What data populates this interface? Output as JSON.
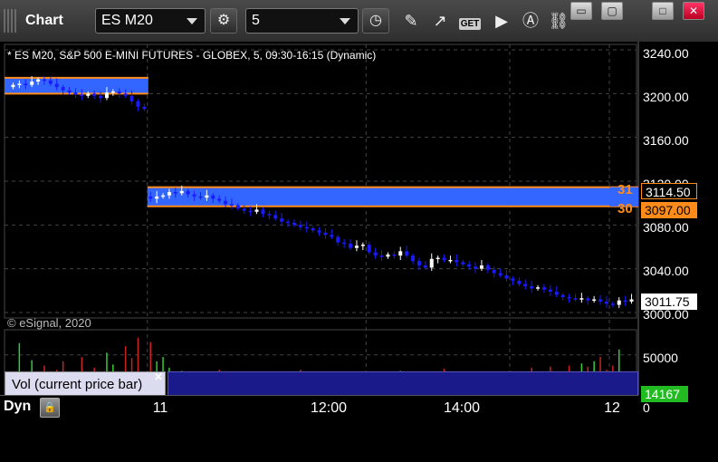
{
  "window": {
    "title": "Chart",
    "controls": [
      "▭",
      "▢",
      "□",
      "✕"
    ]
  },
  "toolbar": {
    "symbol": "ES M20",
    "interval": "5"
  },
  "chart": {
    "header": "* ES M20, S&P 500 E-MINI FUTURES - GLOBEX, 5, 09:30-16:15 (Dynamic)",
    "copyright": "© eSignal, 2020",
    "price_labels": [
      "3240.00",
      "3200.00",
      "3160.00",
      "3120.00",
      "3080.00",
      "3040.00",
      "3000.00"
    ],
    "band_high": {
      "value": "3114.50",
      "left_cut": "31"
    },
    "band_low": {
      "value": "3097.00",
      "left_cut": "30"
    },
    "last_price": "3011.75",
    "volume_labels": [
      "50000",
      "0"
    ],
    "last_volume": "14167",
    "volume_study": "Vol (current price bar)",
    "time_labels": [
      "11",
      "12:00",
      "14:00",
      "12"
    ],
    "mode": "Dyn",
    "colors": {
      "band_fill": "#3366ff",
      "band_edge": "#ff8c1a",
      "up": "#ffffff",
      "down": "#1a1aff",
      "vol_up": "#33cc33",
      "vol_down": "#cc2222"
    }
  },
  "chart_data": {
    "type": "candlestick",
    "title": "* ES M20, S&P 500 E-MINI FUTURES - GLOBEX, 5, 09:30-16:15 (Dynamic)",
    "xlabel": "",
    "ylabel": "",
    "ylim": [
      2995,
      3245
    ],
    "bands": [
      {
        "session": 1,
        "top": 3214.5,
        "bottom": 3200.0
      },
      {
        "session": 2,
        "top": 3114.5,
        "bottom": 3097.0
      }
    ],
    "sessions": [
      {
        "start": 0,
        "end": 21
      },
      {
        "start": 22,
        "end": 99
      }
    ],
    "close_series": [
      3208,
      3209,
      3208,
      3211,
      3213,
      3212,
      3209,
      3206,
      3203,
      3201,
      3199,
      3198,
      3200,
      3198,
      3196,
      3201,
      3202,
      3200,
      3198,
      3193,
      3188,
      3186,
      3104,
      3106,
      3107,
      3110,
      3109,
      3111,
      3108,
      3106,
      3105,
      3107,
      3104,
      3102,
      3099,
      3098,
      3095,
      3093,
      3092,
      3094,
      3090,
      3089,
      3086,
      3083,
      3082,
      3080,
      3078,
      3077,
      3075,
      3073,
      3071,
      3069,
      3064,
      3063,
      3059,
      3061,
      3062,
      3055,
      3052,
      3051,
      3053,
      3052,
      3056,
      3052,
      3047,
      3043,
      3041,
      3049,
      3050,
      3048,
      3048,
      3046,
      3044,
      3042,
      3040,
      3043,
      3039,
      3036,
      3034,
      3031,
      3029,
      3026,
      3024,
      3022,
      3023,
      3021,
      3019,
      3016,
      3014,
      3013,
      3012,
      3013,
      3011,
      3012,
      3010,
      3008,
      3007,
      3011,
      3010,
      3012
    ],
    "volume_series": [
      32000,
      61000,
      22000,
      45000,
      28000,
      40000,
      19000,
      36000,
      44000,
      25000,
      30000,
      48000,
      27000,
      38000,
      33000,
      52000,
      41000,
      29000,
      58000,
      47000,
      66000,
      24000,
      62000,
      44000,
      48000,
      38000,
      29000,
      35000,
      26000,
      30000,
      32000,
      28000,
      22000,
      36000,
      34000,
      24000,
      30000,
      27000,
      33000,
      23000,
      26000,
      29000,
      31000,
      30000,
      22000,
      24000,
      36000,
      28000,
      21000,
      26000,
      33000,
      30000,
      27000,
      25000,
      22000,
      29000,
      31000,
      24000,
      20000,
      26000,
      28000,
      23000,
      35000,
      30000,
      34000,
      25000,
      29000,
      31000,
      24000,
      37000,
      22000,
      30000,
      27000,
      21000,
      26000,
      32000,
      28000,
      30000,
      33000,
      23000,
      26000,
      25000,
      30000,
      38000,
      29000,
      32000,
      39000,
      26000,
      31000,
      40000,
      33000,
      42000,
      39000,
      44000,
      48000,
      36000,
      40000,
      55000,
      22000,
      14167
    ],
    "volume_ylim": [
      0,
      70000
    ],
    "x_ticks": [
      "11",
      "12:00",
      "14:00",
      "12"
    ]
  }
}
